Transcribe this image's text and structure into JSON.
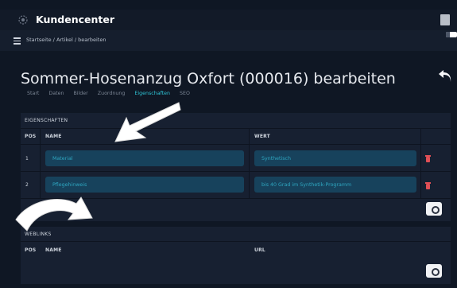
{
  "header": {
    "app_title": "Kundencenter",
    "brand_icon": "settings-circle-icon",
    "avatar_icon": "user-avatar-icon"
  },
  "breadcrumb": {
    "text": "Startseite / Artikel / bearbeiten",
    "menu_icon": "hamburger-menu-icon"
  },
  "page": {
    "title": "Sommer-Hosenanzug Oxfort (000016) bearbeiten",
    "back_icon": "undo-arrow-icon"
  },
  "tabs": [
    {
      "label": "Start",
      "active": false
    },
    {
      "label": "Daten",
      "active": false
    },
    {
      "label": "Bilder",
      "active": false
    },
    {
      "label": "Zuordnung",
      "active": false
    },
    {
      "label": "Eigenschaften",
      "active": true
    },
    {
      "label": "SEO",
      "active": false
    }
  ],
  "properties": {
    "section_title": "EIGENSCHAFTEN",
    "columns": {
      "pos": "POS",
      "name": "NAME",
      "value": "WERT"
    },
    "rows": [
      {
        "pos": "1",
        "name": "Material",
        "value": "Synthetisch"
      },
      {
        "pos": "2",
        "name": "Pflegehinweis",
        "value": "bis 40 Grad im Synthetik-Programm"
      }
    ]
  },
  "weblinks": {
    "section_title": "WEBLINKS",
    "columns": {
      "pos": "POS",
      "name": "NAME",
      "url": "URL"
    }
  },
  "colors": {
    "accent": "#2ec4d6",
    "field_bg": "#17425c",
    "field_text": "#2ea6c0",
    "delete": "#e04f56",
    "card_bg": "#172031",
    "page_bg": "#0f1724"
  }
}
